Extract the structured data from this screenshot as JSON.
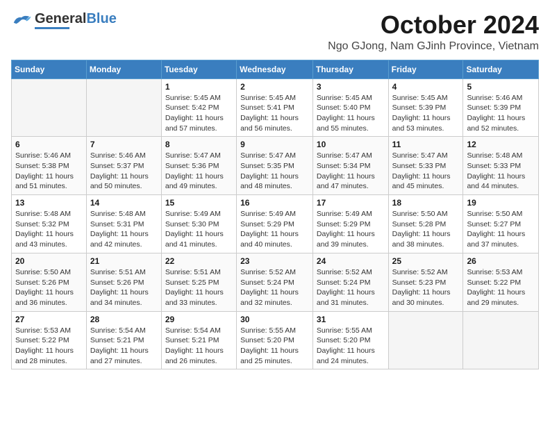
{
  "header": {
    "logo": {
      "general": "General",
      "blue": "Blue"
    },
    "month": "October 2024",
    "location": "Ngo GJong, Nam GJinh Province, Vietnam"
  },
  "weekdays": [
    "Sunday",
    "Monday",
    "Tuesday",
    "Wednesday",
    "Thursday",
    "Friday",
    "Saturday"
  ],
  "weeks": [
    [
      {
        "day": "",
        "info": ""
      },
      {
        "day": "",
        "info": ""
      },
      {
        "day": "1",
        "info": "Sunrise: 5:45 AM\nSunset: 5:42 PM\nDaylight: 11 hours and 57 minutes."
      },
      {
        "day": "2",
        "info": "Sunrise: 5:45 AM\nSunset: 5:41 PM\nDaylight: 11 hours and 56 minutes."
      },
      {
        "day": "3",
        "info": "Sunrise: 5:45 AM\nSunset: 5:40 PM\nDaylight: 11 hours and 55 minutes."
      },
      {
        "day": "4",
        "info": "Sunrise: 5:45 AM\nSunset: 5:39 PM\nDaylight: 11 hours and 53 minutes."
      },
      {
        "day": "5",
        "info": "Sunrise: 5:46 AM\nSunset: 5:39 PM\nDaylight: 11 hours and 52 minutes."
      }
    ],
    [
      {
        "day": "6",
        "info": "Sunrise: 5:46 AM\nSunset: 5:38 PM\nDaylight: 11 hours and 51 minutes."
      },
      {
        "day": "7",
        "info": "Sunrise: 5:46 AM\nSunset: 5:37 PM\nDaylight: 11 hours and 50 minutes."
      },
      {
        "day": "8",
        "info": "Sunrise: 5:47 AM\nSunset: 5:36 PM\nDaylight: 11 hours and 49 minutes."
      },
      {
        "day": "9",
        "info": "Sunrise: 5:47 AM\nSunset: 5:35 PM\nDaylight: 11 hours and 48 minutes."
      },
      {
        "day": "10",
        "info": "Sunrise: 5:47 AM\nSunset: 5:34 PM\nDaylight: 11 hours and 47 minutes."
      },
      {
        "day": "11",
        "info": "Sunrise: 5:47 AM\nSunset: 5:33 PM\nDaylight: 11 hours and 45 minutes."
      },
      {
        "day": "12",
        "info": "Sunrise: 5:48 AM\nSunset: 5:33 PM\nDaylight: 11 hours and 44 minutes."
      }
    ],
    [
      {
        "day": "13",
        "info": "Sunrise: 5:48 AM\nSunset: 5:32 PM\nDaylight: 11 hours and 43 minutes."
      },
      {
        "day": "14",
        "info": "Sunrise: 5:48 AM\nSunset: 5:31 PM\nDaylight: 11 hours and 42 minutes."
      },
      {
        "day": "15",
        "info": "Sunrise: 5:49 AM\nSunset: 5:30 PM\nDaylight: 11 hours and 41 minutes."
      },
      {
        "day": "16",
        "info": "Sunrise: 5:49 AM\nSunset: 5:29 PM\nDaylight: 11 hours and 40 minutes."
      },
      {
        "day": "17",
        "info": "Sunrise: 5:49 AM\nSunset: 5:29 PM\nDaylight: 11 hours and 39 minutes."
      },
      {
        "day": "18",
        "info": "Sunrise: 5:50 AM\nSunset: 5:28 PM\nDaylight: 11 hours and 38 minutes."
      },
      {
        "day": "19",
        "info": "Sunrise: 5:50 AM\nSunset: 5:27 PM\nDaylight: 11 hours and 37 minutes."
      }
    ],
    [
      {
        "day": "20",
        "info": "Sunrise: 5:50 AM\nSunset: 5:26 PM\nDaylight: 11 hours and 36 minutes."
      },
      {
        "day": "21",
        "info": "Sunrise: 5:51 AM\nSunset: 5:26 PM\nDaylight: 11 hours and 34 minutes."
      },
      {
        "day": "22",
        "info": "Sunrise: 5:51 AM\nSunset: 5:25 PM\nDaylight: 11 hours and 33 minutes."
      },
      {
        "day": "23",
        "info": "Sunrise: 5:52 AM\nSunset: 5:24 PM\nDaylight: 11 hours and 32 minutes."
      },
      {
        "day": "24",
        "info": "Sunrise: 5:52 AM\nSunset: 5:24 PM\nDaylight: 11 hours and 31 minutes."
      },
      {
        "day": "25",
        "info": "Sunrise: 5:52 AM\nSunset: 5:23 PM\nDaylight: 11 hours and 30 minutes."
      },
      {
        "day": "26",
        "info": "Sunrise: 5:53 AM\nSunset: 5:22 PM\nDaylight: 11 hours and 29 minutes."
      }
    ],
    [
      {
        "day": "27",
        "info": "Sunrise: 5:53 AM\nSunset: 5:22 PM\nDaylight: 11 hours and 28 minutes."
      },
      {
        "day": "28",
        "info": "Sunrise: 5:54 AM\nSunset: 5:21 PM\nDaylight: 11 hours and 27 minutes."
      },
      {
        "day": "29",
        "info": "Sunrise: 5:54 AM\nSunset: 5:21 PM\nDaylight: 11 hours and 26 minutes."
      },
      {
        "day": "30",
        "info": "Sunrise: 5:55 AM\nSunset: 5:20 PM\nDaylight: 11 hours and 25 minutes."
      },
      {
        "day": "31",
        "info": "Sunrise: 5:55 AM\nSunset: 5:20 PM\nDaylight: 11 hours and 24 minutes."
      },
      {
        "day": "",
        "info": ""
      },
      {
        "day": "",
        "info": ""
      }
    ]
  ]
}
